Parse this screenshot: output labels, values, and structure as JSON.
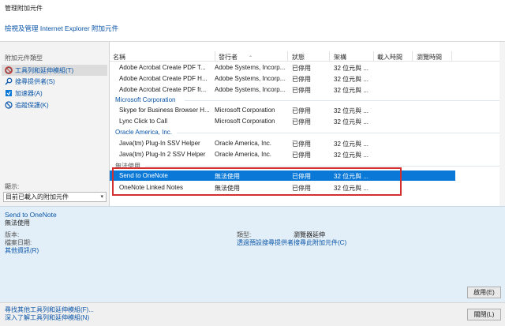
{
  "window": {
    "title": "管理附加元件"
  },
  "top_link": "檢視及管理 Internet Explorer 附加元件",
  "sidebar": {
    "header": "附加元件類型",
    "items": [
      {
        "label": "工具列和延伸模組(T)",
        "icon": "gear-blocked-icon"
      },
      {
        "label": "搜尋提供者(S)",
        "icon": "search-icon"
      },
      {
        "label": "加速器(A)",
        "icon": "accelerator-icon"
      },
      {
        "label": "追蹤保護(K)",
        "icon": "tracking-protection-icon"
      }
    ],
    "show_label": "顯示:",
    "show_value": "目前已載入的附加元件"
  },
  "columns": [
    "名稱",
    "發行者",
    "狀態",
    "架構",
    "載入時間",
    "瀏覽時間"
  ],
  "groups": [
    {
      "name": "",
      "rows": [
        [
          "Adobe Acrobat Create PDF T...",
          "Adobe Systems, Incorp...",
          "已停用",
          "32 位元與 ..."
        ],
        [
          "Adobe Acrobat Create PDF H...",
          "Adobe Systems, Incorp...",
          "已停用",
          "32 位元與 ..."
        ],
        [
          "Adobe Acrobat Create PDF fr...",
          "Adobe Systems, Incorp...",
          "已停用",
          "32 位元與 ..."
        ]
      ]
    },
    {
      "name": "Microsoft Corporation",
      "rows": [
        [
          "Skype for Business Browser H...",
          "Microsoft Corporation",
          "已停用",
          "32 位元與 ..."
        ],
        [
          "Lync Click to Call",
          "Microsoft Corporation",
          "已停用",
          "32 位元與 ..."
        ]
      ]
    },
    {
      "name": "Oracle America, Inc.",
      "rows": [
        [
          "Java(tm) Plug-In SSV Helper",
          "Oracle America, Inc.",
          "已停用",
          "32 位元與 ..."
        ],
        [
          "Java(tm) Plug-In 2 SSV Helper",
          "Oracle America, Inc.",
          "已停用",
          "32 位元與 ..."
        ]
      ]
    },
    {
      "name": "無法使用",
      "rows": [
        [
          "Send to OneNote",
          "無法使用",
          "已停用",
          "32 位元與 ..."
        ],
        [
          "OneNote Linked Notes",
          "無法使用",
          "已停用",
          "32 位元與 ..."
        ]
      ]
    }
  ],
  "selected_row": "Send to OneNote",
  "details": {
    "name": "Send to OneNote",
    "publisher": "無法使用",
    "version_label": "版本:",
    "filedate_label": "檔案日期:",
    "more_info": "其他資訊(R)",
    "type_label": "類型:",
    "type_value": "瀏覽器延伸",
    "search_link": "透過預設搜尋提供者搜尋此附加元件(C)",
    "enable_button": "啟用(E)"
  },
  "footer": {
    "link1": "尋找其他工具列和延伸模組(F)...",
    "link2": "深入了解工具列和延伸模組(N)",
    "close_button": "關閉(L)"
  },
  "colors": {
    "accent": "#0a78d7",
    "link": "#0b56a8",
    "highlight_box": "#d32f2f",
    "details_bg": "#e3eff8"
  }
}
